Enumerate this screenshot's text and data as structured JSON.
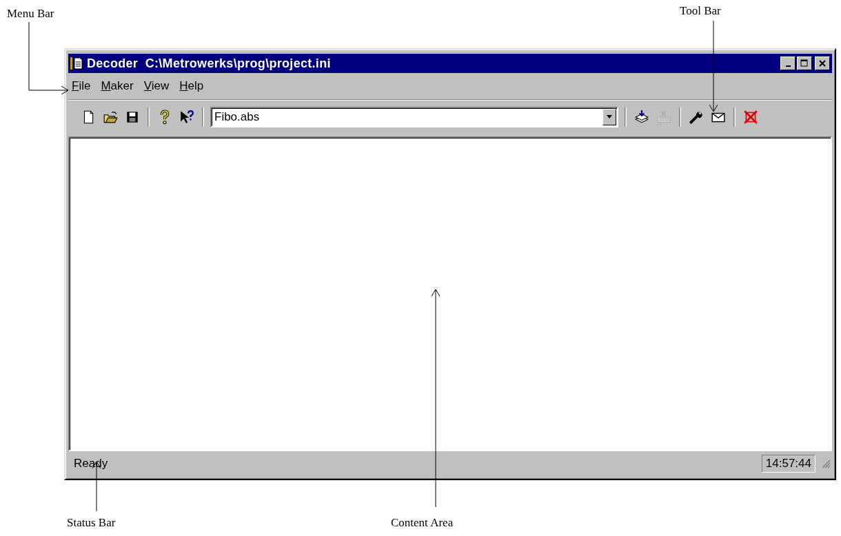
{
  "annotations": [
    {
      "label": "Menu Bar"
    },
    {
      "label": "Tool Bar"
    },
    {
      "label": "Status Bar"
    },
    {
      "label": "Content Area"
    }
  ],
  "window": {
    "title": "Decoder  C:\\Metrowerks\\prog\\project.ini"
  },
  "menu": [
    {
      "label": "File"
    },
    {
      "label": "Maker"
    },
    {
      "label": "View"
    },
    {
      "label": "Help"
    }
  ],
  "toolbar": {
    "buttons": [
      {
        "disabled": false
      },
      {
        "disabled": false
      },
      {
        "disabled": false
      },
      {
        "disabled": false
      },
      {
        "disabled": false
      },
      {
        "disabled": false
      },
      {
        "disabled": true
      },
      {
        "disabled": false
      },
      {
        "disabled": false
      },
      {
        "disabled": false
      }
    ],
    "combo": {
      "value": "Fibo.abs"
    }
  },
  "status_bar": {
    "text": "Ready",
    "clock": "14:57:44"
  }
}
